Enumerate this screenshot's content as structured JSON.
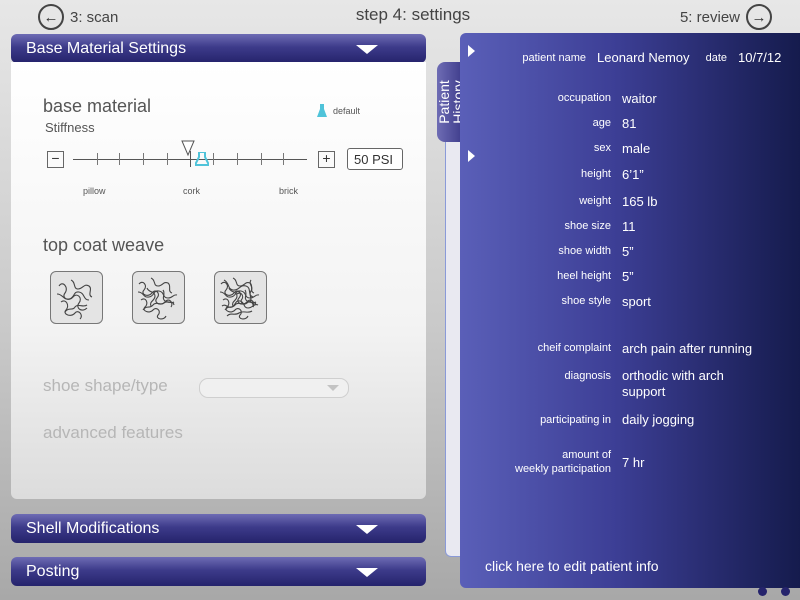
{
  "nav": {
    "back_label": "3: scan",
    "title": "step 4: settings",
    "next_label": "5: review"
  },
  "panels": {
    "base": {
      "title": "Base Material Settings",
      "heading": "base material",
      "stiffness_label": "Stiffness",
      "default_legend": "default",
      "slider": {
        "value_display": "50 PSI",
        "marks": [
          "pillow",
          "cork",
          "brick"
        ],
        "minus": "−",
        "plus": "+",
        "level": 0.5
      },
      "weave_heading": "top coat weave",
      "weave_options": [
        "loose weave",
        "medium weave",
        "dense weave"
      ],
      "shape_label": "shoe shape/type",
      "advanced_label": "advanced features"
    },
    "shell": {
      "title": "Shell Modifications"
    },
    "posting": {
      "title": "Posting"
    }
  },
  "history": {
    "tab_label_1": "Patient",
    "tab_label_2": "History",
    "patient_name_label": "patient name",
    "patient_name": "Leonard Nemoy",
    "date_label": "date",
    "date": "10/7/12",
    "fields": [
      {
        "label": "occupation",
        "value": "waitor"
      },
      {
        "label": "age",
        "value": "81"
      },
      {
        "label": "sex",
        "value": "male"
      },
      {
        "label": "height",
        "value": "6’1”"
      },
      {
        "label": "weight",
        "value": "165 lb"
      },
      {
        "label": "shoe size",
        "value": "11"
      },
      {
        "label": "shoe width",
        "value": "5”"
      },
      {
        "label": "heel height",
        "value": "5”"
      },
      {
        "label": "shoe style",
        "value": "sport"
      }
    ],
    "complaint_label": "cheif complaint",
    "complaint": "arch pain after running",
    "diagnosis_label": "diagnosis",
    "diagnosis_line1": "orthodic with arch",
    "diagnosis_line2": "support",
    "participating_label": "participating in",
    "participating": "daily jogging",
    "amount_label_1": "amount of",
    "amount_label_2": "weekly participation",
    "amount": "7 hr",
    "edit_label": "click here to edit patient info"
  },
  "colors": {
    "header": "#3d3b8a",
    "panel": "#3d3f96",
    "accent": "#4fc3d9"
  },
  "icons": {
    "back": "arrow-left-icon",
    "next": "arrow-right-icon",
    "collapse": "triangle-down-icon",
    "expand": "play-icon",
    "default": "flask-icon"
  }
}
